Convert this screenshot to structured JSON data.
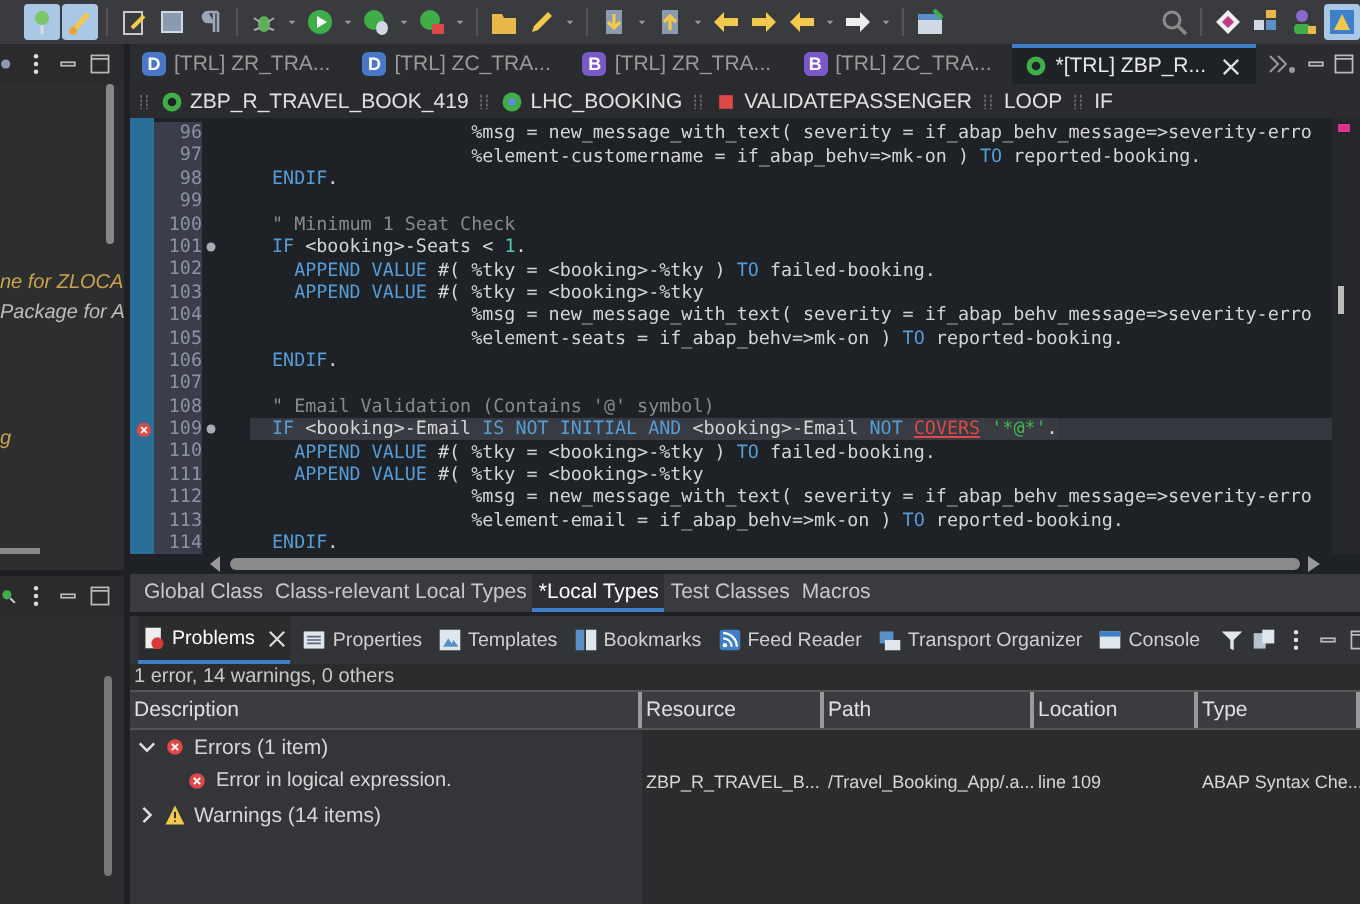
{
  "toolbar": {
    "left": [
      {
        "kind": "pin",
        "pressed": true
      },
      {
        "kind": "brush",
        "pressed": true
      },
      {
        "kind": "sep"
      },
      {
        "kind": "doc-edit",
        "pressed": false
      },
      {
        "kind": "square",
        "pressed": false
      },
      {
        "kind": "pilcrow",
        "pressed": false
      },
      {
        "kind": "sep"
      },
      {
        "kind": "bug",
        "pressed": false
      },
      {
        "kind": "caret",
        "pressed": false
      },
      {
        "kind": "run",
        "pressed": false
      },
      {
        "kind": "caret",
        "pressed": false
      },
      {
        "kind": "debug-run",
        "pressed": false
      },
      {
        "kind": "caret",
        "pressed": false
      },
      {
        "kind": "stop-run",
        "pressed": false
      },
      {
        "kind": "caret",
        "pressed": false
      },
      {
        "kind": "sep"
      },
      {
        "kind": "folder",
        "pressed": false
      },
      {
        "kind": "pencil",
        "pressed": false
      },
      {
        "kind": "caret",
        "pressed": false
      },
      {
        "kind": "sep"
      },
      {
        "kind": "down-doc",
        "pressed": false
      },
      {
        "kind": "caret",
        "pressed": false
      },
      {
        "kind": "up-doc",
        "pressed": false
      },
      {
        "kind": "caret",
        "pressed": false
      },
      {
        "kind": "arrow-left",
        "pressed": false
      },
      {
        "kind": "arrow-right",
        "pressed": false
      },
      {
        "kind": "arrow-left",
        "pressed": false
      },
      {
        "kind": "caret",
        "pressed": false
      },
      {
        "kind": "arrow-right-white",
        "pressed": false
      },
      {
        "kind": "caret",
        "pressed": false
      },
      {
        "kind": "sep"
      },
      {
        "kind": "window",
        "pressed": false
      }
    ],
    "right": [
      {
        "kind": "search",
        "pressed": false
      },
      {
        "kind": "sep"
      },
      {
        "kind": "gem",
        "pressed": false
      },
      {
        "kind": "tiles",
        "pressed": false
      },
      {
        "kind": "person",
        "pressed": false
      },
      {
        "kind": "perspective",
        "pressed": true
      }
    ]
  },
  "left_panel": {
    "texts": [
      {
        "text": "ne for ZLOCA",
        "kind": "accent"
      },
      {
        "text": "Package for A",
        "kind": "plain"
      },
      {
        "text": "g",
        "kind": "accent"
      }
    ]
  },
  "editor_tabs": [
    {
      "badge": "D",
      "kind": "ddl",
      "label": "[TRL] ZR_TRA...",
      "selected": false
    },
    {
      "badge": "D",
      "kind": "ddl",
      "label": "[TRL] ZC_TRA...",
      "selected": false
    },
    {
      "badge": "B",
      "kind": "bdef",
      "label": "[TRL] ZR_TRA...",
      "selected": false
    },
    {
      "badge": "B",
      "kind": "bdef",
      "label": "[TRL] ZC_TRA...",
      "selected": false
    },
    {
      "kind": "class",
      "label": "*[TRL] ZBP_R...",
      "selected": true
    }
  ],
  "breadcrumb": [
    {
      "kind": "class",
      "label": "ZBP_R_TRAVEL_BOOK_419"
    },
    {
      "kind": "local-class",
      "label": "LHC_BOOKING"
    },
    {
      "kind": "method",
      "label": "VALIDATEPASSENGER"
    },
    {
      "kind": "plain",
      "label": "LOOP"
    },
    {
      "kind": "plain",
      "label": "IF"
    }
  ],
  "code": [
    {
      "number": "96",
      "highlighted": false,
      "segments": [
        {
          "kind": "plain",
          "text": "                  %msg = new_message_with_text( severity = if_abap_behv_message=>severity-erro"
        }
      ]
    },
    {
      "number": "97",
      "highlighted": false,
      "segments": [
        {
          "kind": "plain",
          "text": "                  %element-customername = if_abap_behv=>mk-on ) "
        },
        {
          "kind": "kw",
          "text": "TO"
        },
        {
          "kind": "plain",
          "text": " reported-booking."
        }
      ]
    },
    {
      "number": "98",
      "highlighted": false,
      "segments": [
        {
          "kind": "kw",
          "text": "ENDIF"
        },
        {
          "kind": "plain",
          "text": "."
        }
      ]
    },
    {
      "number": "99",
      "highlighted": false
    },
    {
      "number": "100",
      "highlighted": false,
      "segments": [
        {
          "kind": "comment",
          "text": "\" Minimum 1 Seat Check"
        }
      ]
    },
    {
      "number": "101",
      "highlighted": false,
      "fold_marker": true,
      "error": false,
      "segments": [
        {
          "kind": "kw",
          "text": "IF"
        },
        {
          "kind": "plain",
          "text": " <booking>-Seats < "
        },
        {
          "kind": "number",
          "text": "1"
        },
        {
          "kind": "plain",
          "text": "."
        }
      ]
    },
    {
      "number": "102",
      "highlighted": false,
      "segments": [
        {
          "kind": "kw",
          "text": "  APPEND VALUE"
        },
        {
          "kind": "plain",
          "text": " #( %tky = <booking>-%tky ) "
        },
        {
          "kind": "kw",
          "text": "TO"
        },
        {
          "kind": "plain",
          "text": " failed-booking."
        }
      ]
    },
    {
      "number": "103",
      "highlighted": false,
      "segments": [
        {
          "kind": "kw",
          "text": "  APPEND VALUE"
        },
        {
          "kind": "plain",
          "text": " #( %tky = <booking>-%tky"
        }
      ]
    },
    {
      "number": "104",
      "highlighted": false,
      "segments": [
        {
          "kind": "plain",
          "text": "                  %msg = new_message_with_text( severity = if_abap_behv_message=>severity-erro"
        }
      ]
    },
    {
      "number": "105",
      "highlighted": false,
      "segments": [
        {
          "kind": "plain",
          "text": "                  %element-seats = if_abap_behv=>mk-on ) "
        },
        {
          "kind": "kw",
          "text": "TO"
        },
        {
          "kind": "plain",
          "text": " reported-booking."
        }
      ]
    },
    {
      "number": "106",
      "highlighted": false,
      "segments": [
        {
          "kind": "kw",
          "text": "ENDIF"
        },
        {
          "kind": "plain",
          "text": "."
        }
      ]
    },
    {
      "number": "107",
      "highlighted": false
    },
    {
      "number": "108",
      "highlighted": false,
      "segments": [
        {
          "kind": "comment",
          "text": "\" Email Validation (Contains '@' symbol)"
        }
      ]
    },
    {
      "number": "109",
      "highlighted": true,
      "fold_marker": true,
      "error": true,
      "segments": [
        {
          "kind": "kw",
          "text": "IF"
        },
        {
          "kind": "plain",
          "text": " <booking>-Email "
        },
        {
          "kind": "kw",
          "text": "IS NOT INITIAL AND"
        },
        {
          "kind": "plain",
          "text": " <booking>-Email "
        },
        {
          "kind": "kw",
          "text": "NOT "
        },
        {
          "kind": "error",
          "text": "COVERS"
        },
        {
          "kind": "string",
          "text": " '*@*'"
        },
        {
          "kind": "plain",
          "text": "."
        }
      ]
    },
    {
      "number": "110",
      "highlighted": false,
      "segments": [
        {
          "kind": "kw",
          "text": "  APPEND VALUE"
        },
        {
          "kind": "plain",
          "text": " #( %tky = <booking>-%tky ) "
        },
        {
          "kind": "kw",
          "text": "TO"
        },
        {
          "kind": "plain",
          "text": " failed-booking."
        }
      ]
    },
    {
      "number": "111",
      "highlighted": false,
      "segments": [
        {
          "kind": "kw",
          "text": "  APPEND VALUE"
        },
        {
          "kind": "plain",
          "text": " #( %tky = <booking>-%tky"
        }
      ]
    },
    {
      "number": "112",
      "highlighted": false,
      "segments": [
        {
          "kind": "plain",
          "text": "                  %msg = new_message_with_text( severity = if_abap_behv_message=>severity-erro"
        }
      ]
    },
    {
      "number": "113",
      "highlighted": false,
      "segments": [
        {
          "kind": "plain",
          "text": "                  %element-email = if_abap_behv=>mk-on ) "
        },
        {
          "kind": "kw",
          "text": "TO"
        },
        {
          "kind": "plain",
          "text": " reported-booking."
        }
      ]
    },
    {
      "number": "114",
      "highlighted": false,
      "segments": [
        {
          "kind": "kw",
          "text": "ENDIF"
        },
        {
          "kind": "plain",
          "text": "."
        }
      ]
    }
  ],
  "source_tabs": [
    {
      "label": "Global Class",
      "selected": false
    },
    {
      "label": "Class-relevant Local Types",
      "selected": false
    },
    {
      "label": "*Local Types",
      "selected": true
    },
    {
      "label": "Test Classes",
      "selected": false
    },
    {
      "label": "Macros",
      "selected": false
    }
  ],
  "view_tabs": [
    {
      "kind": "problems",
      "label": "Problems",
      "selected": true
    },
    {
      "kind": "properties",
      "label": "Properties",
      "selected": false
    },
    {
      "kind": "templates",
      "label": "Templates",
      "selected": false
    },
    {
      "kind": "bookmarks",
      "label": "Bookmarks",
      "selected": false
    },
    {
      "kind": "feed",
      "label": "Feed Reader",
      "selected": false
    },
    {
      "kind": "transport",
      "label": "Transport Organizer",
      "selected": false
    },
    {
      "kind": "console",
      "label": "Console",
      "selected": false
    }
  ],
  "problems": {
    "summary": "1 error, 14 warnings, 0 others",
    "columns": [
      "Description",
      "Resource",
      "Path",
      "Location",
      "Type"
    ],
    "rows": [
      {
        "kind": "error",
        "label": "Errors (1 item)",
        "expanded": true,
        "children": [
          {
            "kind": "error",
            "description": "Error in logical expression.",
            "resource": "ZBP_R_TRAVEL_B...",
            "path": "/Travel_Booking_App/.a...",
            "location": "line 109",
            "type": "ABAP Syntax Che..."
          }
        ]
      },
      {
        "kind": "warning",
        "label": "Warnings (14 items)",
        "expanded": false
      }
    ]
  }
}
